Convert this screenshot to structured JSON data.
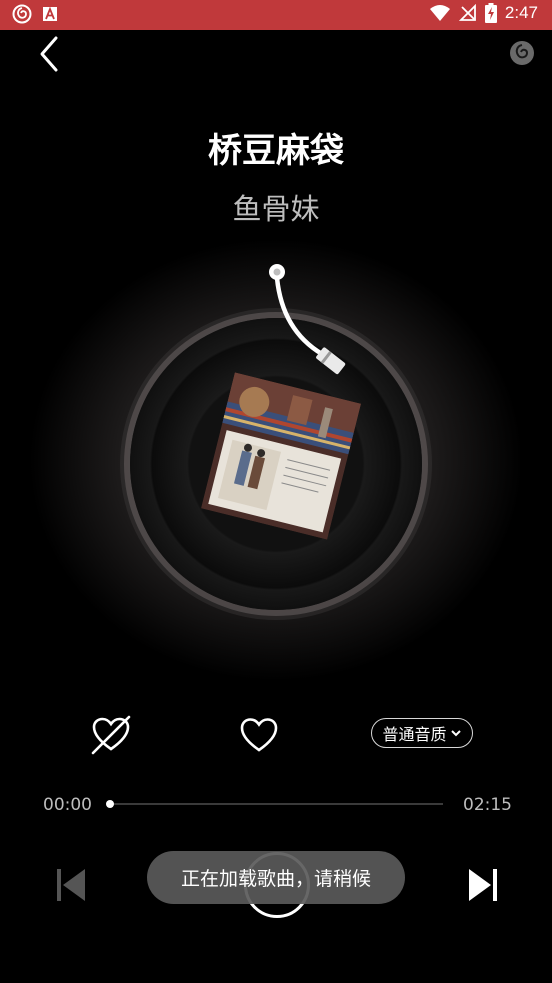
{
  "status_bar": {
    "time": "2:47",
    "icons": [
      "netease-icon",
      "font-icon",
      "wifi-icon",
      "no-signal-icon",
      "battery-charging-icon"
    ],
    "color": "#c0393b"
  },
  "header": {
    "back_icon": "chevron-left-icon",
    "share_icon": "netease-logo-icon"
  },
  "song": {
    "title": "桥豆麻袋",
    "artist": "鱼骨妹"
  },
  "controls": {
    "dislike_icon": "heart-crossed-icon",
    "like_icon": "heart-outline-icon",
    "quality_label": "普通音质",
    "quality_icon": "chevron-down-icon"
  },
  "progress": {
    "current_time": "00:00",
    "total_time": "02:15",
    "fraction": 0.0
  },
  "transport": {
    "prev_icon": "skip-previous-icon",
    "play_icon": "play-pause-icon",
    "next_icon": "skip-next-icon"
  },
  "toast": {
    "message": "正在加载歌曲，请稍候"
  }
}
